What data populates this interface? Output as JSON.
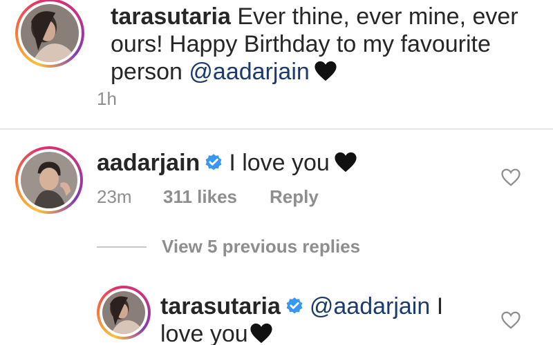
{
  "caption": {
    "username": "tarasutaria",
    "text": " Ever thine, ever mine, ever ours! Happy Birthday to my favourite person ",
    "mention": "@aadarjain",
    "time": "1h"
  },
  "comment": {
    "username": "aadarjain",
    "text": "I love you",
    "time": "23m",
    "likes": "311 likes",
    "reply_label": "Reply"
  },
  "replies": {
    "view_label": "View 5 previous replies"
  },
  "reply": {
    "username": "tarasutaria",
    "mention": "@aadarjain",
    "text": " I love you"
  },
  "colors": {
    "mention": "#1c3a6b",
    "verified": "#3897f0",
    "muted": "#8e8e8e"
  }
}
